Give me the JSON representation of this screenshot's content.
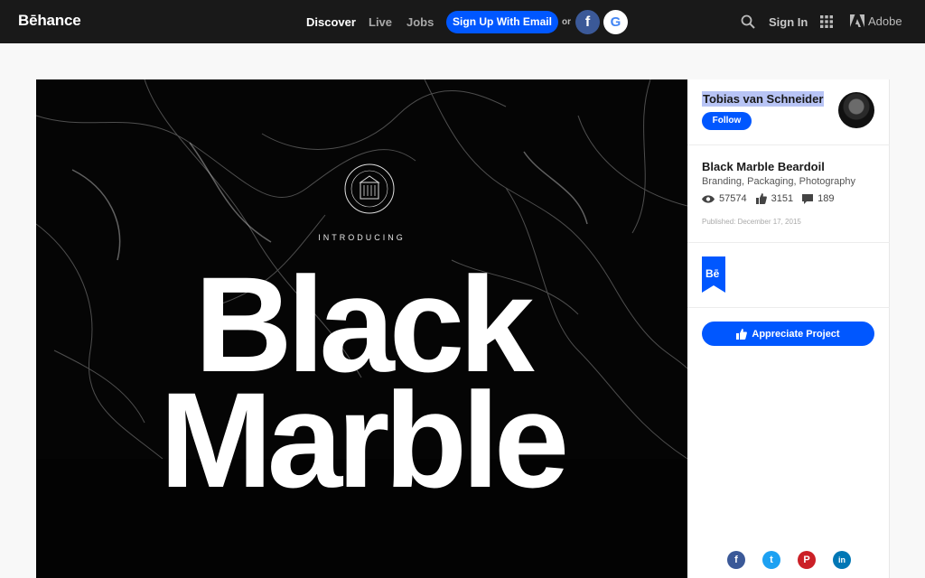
{
  "header": {
    "logo": "Bēhance",
    "nav": {
      "discover": "Discover",
      "live": "Live",
      "jobs": "Jobs"
    },
    "signup_label": "Sign Up With Email",
    "or_label": "or",
    "facebook_glyph": "f",
    "google_glyph": "G",
    "signin_label": "Sign In",
    "adobe_label": "Adobe"
  },
  "artwork": {
    "intro_text": "INTRODUCING",
    "title_line1": "Black",
    "title_line2": "Marble"
  },
  "sidebar": {
    "owner_name": "Tobias van Schneider",
    "follow_label": "Follow",
    "project_title": "Black Marble Beardoil",
    "fields": "Branding, Packaging, Photography",
    "views": "57574",
    "appreciations": "3151",
    "comments": "189",
    "published": "Published: December 17, 2015",
    "badge_text": "Bē",
    "appreciate_label": "Appreciate Project"
  },
  "share": [
    {
      "name": "facebook",
      "glyph": "f",
      "color": "#3b5998"
    },
    {
      "name": "twitter",
      "glyph": "t",
      "color": "#1da1f2"
    },
    {
      "name": "pinterest",
      "glyph": "P",
      "color": "#cb2027"
    },
    {
      "name": "linkedin",
      "glyph": "in",
      "color": "#0077b5"
    }
  ],
  "colors": {
    "brand_blue": "#0057ff",
    "topbar": "#191919",
    "selection": "#b8c4f5"
  }
}
